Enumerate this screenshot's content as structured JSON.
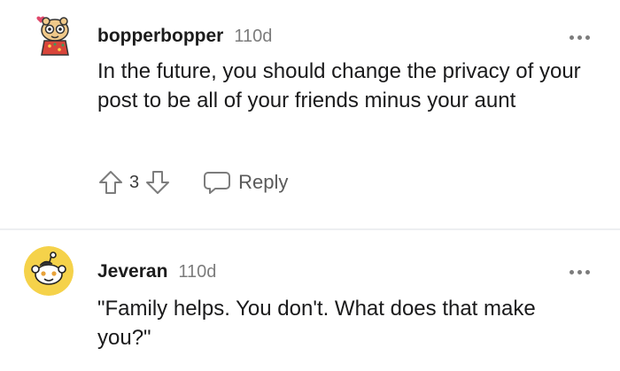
{
  "comments": [
    {
      "username": "bopperbopper",
      "time": "110d",
      "text": "In the future, you should change the privacy of your post to be all of your friends minus your aunt",
      "score": "3",
      "reply_label": "Reply"
    },
    {
      "username": "Jeveran",
      "time": "110d",
      "text": "\"Family helps. You don't. What does that make you?\""
    }
  ],
  "icons": {
    "more_options": "more-options-icon",
    "upvote": "upvote-icon",
    "downvote": "downvote-icon",
    "reply": "reply-icon"
  },
  "colors": {
    "text": "#1a1a1b",
    "muted": "#7c7c7c",
    "divider": "#edeff1",
    "avatar2_bg": "#f5d24a"
  }
}
